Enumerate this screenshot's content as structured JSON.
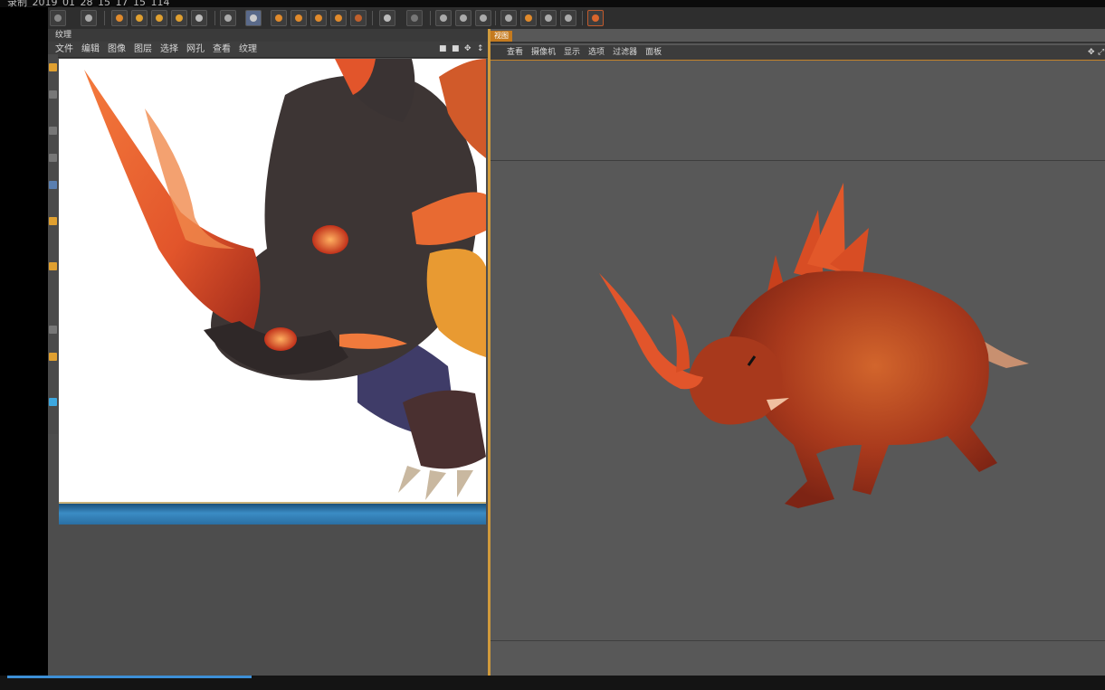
{
  "window": {
    "title": "录制_2019_01_28_15_17_15_114"
  },
  "texture_panel": {
    "title": "纹理",
    "menu": [
      "文件",
      "编辑",
      "图像",
      "图层",
      "选择",
      "网孔",
      "查看",
      "纹理"
    ]
  },
  "viewport_panel": {
    "tab": "视图",
    "menu": [
      "查看",
      "摄像机",
      "显示",
      "选项",
      "过滤器",
      "面板"
    ]
  },
  "colors": {
    "accent": "#d09a3c",
    "horn": "#e2552b",
    "body": "#a8391c",
    "skin": "#3d3534",
    "progress": "#3d8fd6"
  },
  "toolbar_icons": [
    "undo-icon",
    "redo-icon",
    "select-icon",
    "move-icon",
    "scale-icon",
    "rotate-icon",
    "coordinate-icon",
    "render-view-icon",
    "render-icon",
    "render-settings-icon",
    "cube-icon",
    "pen-icon",
    "subdivide-icon",
    "deformer-icon",
    "camera-icon",
    "light-icon"
  ]
}
